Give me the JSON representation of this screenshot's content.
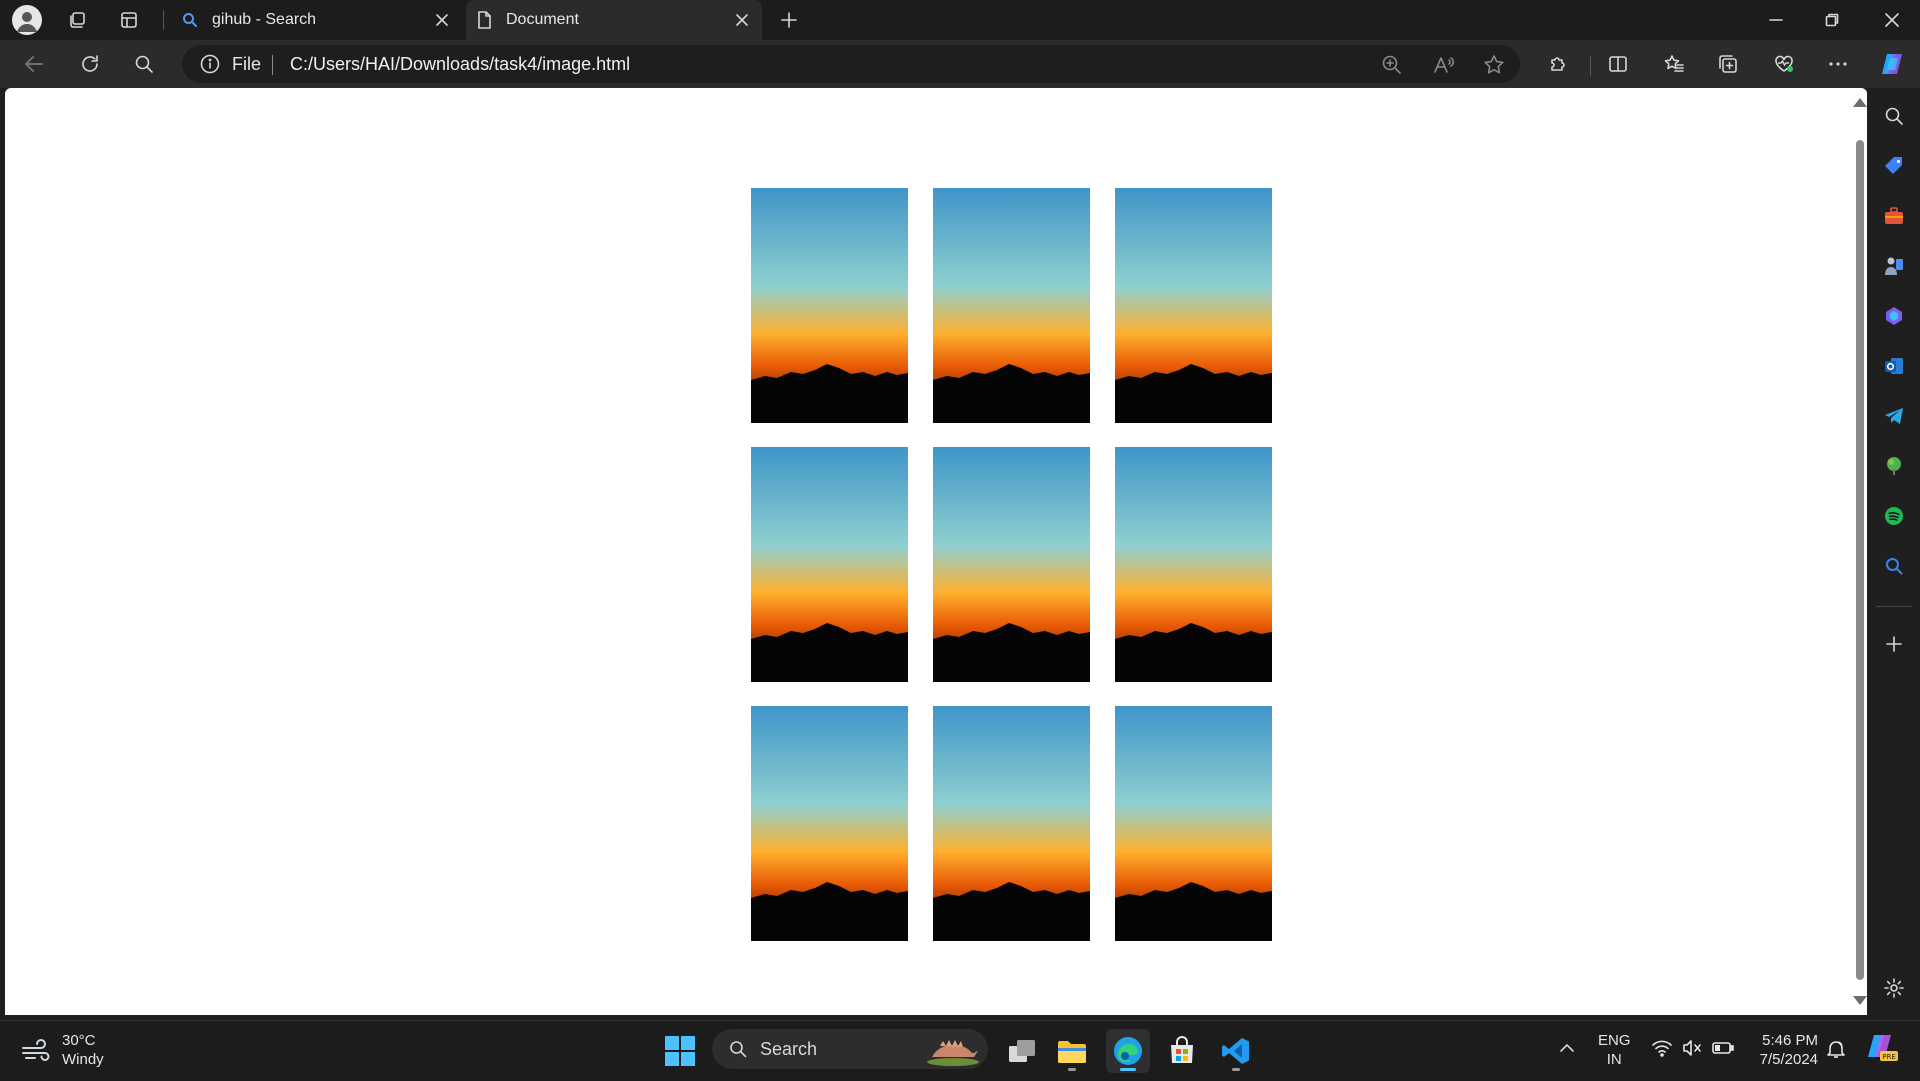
{
  "browser": {
    "tabs": [
      {
        "title": "gihub - Search",
        "icon": "search-icon",
        "active": false
      },
      {
        "title": "Document",
        "icon": "page-icon",
        "active": true
      }
    ],
    "address": {
      "scheme_label": "File",
      "url": "C:/Users/HAI/Downloads/task4/image.html"
    }
  },
  "page": {
    "images": [
      {
        "name": "sunset-image-1"
      },
      {
        "name": "sunset-image-2"
      },
      {
        "name": "sunset-image-3"
      },
      {
        "name": "sunset-image-4"
      },
      {
        "name": "sunset-image-5"
      },
      {
        "name": "sunset-image-6"
      },
      {
        "name": "sunset-image-7"
      },
      {
        "name": "sunset-image-8"
      },
      {
        "name": "sunset-image-9"
      }
    ],
    "image_colors": {
      "sky_top": "#3f95c9",
      "sky_mid": "#8fd0cf",
      "glow": "#ffb02e",
      "horizon": "#e85a05",
      "mountains": "#050505"
    }
  },
  "sidebar": {
    "icons": [
      "search-icon",
      "shopping-tag-icon",
      "tools-briefcase-icon",
      "games-icon",
      "copilot-icon",
      "outlook-icon",
      "telegram-icon",
      "tree-icon",
      "spotify-icon",
      "search-blue-icon",
      "add-icon",
      "settings-icon"
    ]
  },
  "taskbar": {
    "weather": {
      "temp": "30°C",
      "condition": "Windy"
    },
    "search_label": "Search",
    "language": {
      "line1": "ENG",
      "line2": "IN"
    },
    "clock": {
      "time": "5:46 PM",
      "date": "7/5/2024"
    }
  }
}
